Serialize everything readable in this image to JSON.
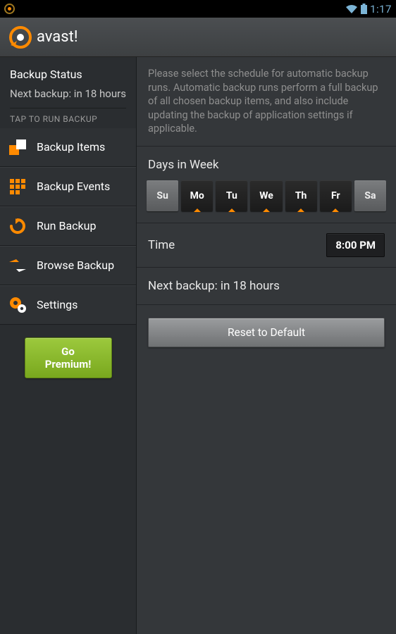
{
  "status_bar": {
    "time": "1:17"
  },
  "app": {
    "title": "avast",
    "bang": "!"
  },
  "sidebar": {
    "status_title": "Backup Status",
    "status_sub": "Next backup: in 18 hours",
    "tap_label": "TAP TO RUN BACKUP",
    "items": [
      {
        "label": "Backup Items"
      },
      {
        "label": "Backup Events"
      },
      {
        "label": "Run Backup"
      },
      {
        "label": "Browse Backup"
      },
      {
        "label": "Settings"
      }
    ],
    "premium_line1": "Go",
    "premium_line2": "Premium!"
  },
  "content": {
    "description": "Please select the schedule for automatic backup runs. Automatic backup runs perform a full backup of all chosen backup items, and also include updating the backup of application settings if applicable.",
    "days_label": "Days in Week",
    "days": [
      {
        "short": "Su",
        "on": false
      },
      {
        "short": "Mo",
        "on": true
      },
      {
        "short": "Tu",
        "on": true
      },
      {
        "short": "We",
        "on": true
      },
      {
        "short": "Th",
        "on": true
      },
      {
        "short": "Fr",
        "on": true
      },
      {
        "short": "Sa",
        "on": false
      }
    ],
    "time_label": "Time",
    "time_value": "8:00 PM",
    "next_backup": "Next backup: in 18 hours",
    "reset_label": "Reset to Default"
  }
}
